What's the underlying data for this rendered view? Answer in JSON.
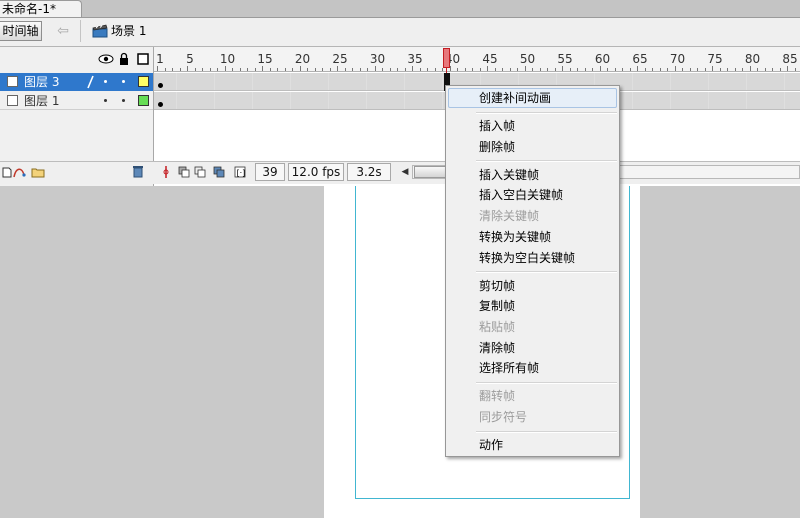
{
  "window": {
    "doc_tab_title": "未命名-1*"
  },
  "toolbar": {
    "timeline_label": "时间轴",
    "scene_label": "场景 1",
    "back_icon": "left-arrow-icon",
    "scene_icon": "clapperboard-icon"
  },
  "timeline": {
    "ruler_labels": [
      "1",
      "5",
      "10",
      "15",
      "20",
      "25",
      "30",
      "35",
      "40",
      "45",
      "50",
      "55",
      "60",
      "65",
      "70",
      "75",
      "80",
      "85"
    ],
    "playhead_frame": 40,
    "layers": [
      {
        "name": "图层 3",
        "selected": true,
        "color": "#ffff66"
      },
      {
        "name": "图层 1",
        "selected": false,
        "color": "#66dd55"
      }
    ],
    "status": {
      "current_frame": "39",
      "fps": "12.0 fps",
      "elapsed": "3.2s"
    }
  },
  "context_menu": {
    "items": [
      {
        "label": "创建补间动画",
        "enabled": true,
        "hover": true
      },
      {
        "label": "插入帧",
        "enabled": true
      },
      {
        "label": "删除帧",
        "enabled": true
      },
      {
        "label": "插入关键帧",
        "enabled": true
      },
      {
        "label": "插入空白关键帧",
        "enabled": true
      },
      {
        "label": "清除关键帧",
        "enabled": false
      },
      {
        "label": "转换为关键帧",
        "enabled": true
      },
      {
        "label": "转换为空白关键帧",
        "enabled": true
      },
      {
        "label": "剪切帧",
        "enabled": true
      },
      {
        "label": "复制帧",
        "enabled": true
      },
      {
        "label": "粘贴帧",
        "enabled": false
      },
      {
        "label": "清除帧",
        "enabled": true
      },
      {
        "label": "选择所有帧",
        "enabled": true
      },
      {
        "label": "翻转帧",
        "enabled": false
      },
      {
        "label": "同步符号",
        "enabled": false
      },
      {
        "label": "动作",
        "enabled": true
      }
    ]
  }
}
